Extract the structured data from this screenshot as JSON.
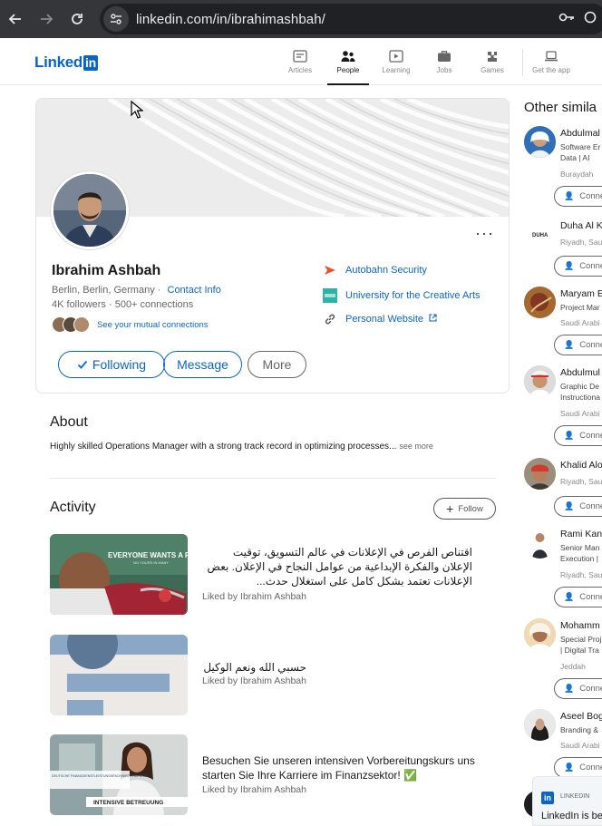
{
  "browser": {
    "url_host": "linkedin.com",
    "url_path": "/in/ibrahimashbah/"
  },
  "nav": {
    "logo_text": "Linked",
    "logo_in": "in",
    "items": [
      {
        "label": "Articles",
        "icon": "articles-icon"
      },
      {
        "label": "People",
        "icon": "people-icon",
        "active": true
      },
      {
        "label": "Learning",
        "icon": "learning-icon"
      },
      {
        "label": "Jobs",
        "icon": "jobs-icon"
      },
      {
        "label": "Games",
        "icon": "games-icon"
      },
      {
        "label": "Get the app",
        "icon": "laptop-icon"
      }
    ]
  },
  "profile": {
    "name": "Ibrahim Ashbah",
    "location": "Berlin, Berlin, Germany",
    "location_sep": " · ",
    "contact_info": "Contact Info",
    "followers": "4K followers",
    "conn_sep": " · ",
    "connections": "500+ connections",
    "mutual": "See your mutual connections",
    "associations": [
      {
        "label": "Autobahn Security",
        "icon": "autobahn-security-logo"
      },
      {
        "label": "University for the Creative Arts",
        "icon": "uca-logo"
      },
      {
        "label": "Personal Website",
        "icon": "link-icon"
      }
    ],
    "buttons": {
      "following": "Following",
      "message": "Message",
      "more": "More"
    },
    "kebab": "···"
  },
  "about": {
    "heading": "About",
    "text": "Highly skilled Operations Manager with a strong track record in optimizing processes...",
    "see_more": "see more"
  },
  "activity": {
    "heading": "Activity",
    "follow_label": "Follow",
    "posts": [
      {
        "text": "اقتناص الفرص في الإعلانات في عالم التسويق، توقيت الإعلان والفكرة الإبداعية من عوامل النجاح في الإعلان. بعض الإعلانات تعتمد بشكل كامل على استغلال حدث...",
        "liked": "Liked by Ibrahim Ashbah",
        "thumb_caption": "EVERYONE WANTS A PAIR",
        "thumb_subcaption": "NO YOURS IN MANY"
      },
      {
        "text": "حسبي الله ونعم الوكيل",
        "liked": "Liked by Ibrahim Ashbah"
      },
      {
        "text": "Besuchen Sie unseren intensiven Vorbereitungskurs uns starten Sie Ihre Karriere im Finanzsektor! ✅",
        "liked": "Liked by Ibrahim Ashbah",
        "thumb_caption": "INTENSIVE BETREUUNG",
        "thumb_small": "DEUTSCHE FINANZDIENSTLEISTUNGSFACHWIRT PRÜFUNG"
      }
    ]
  },
  "sidebar": {
    "heading": "Other simila",
    "connect_label": "Conne",
    "people": [
      {
        "name": "Abdulmal",
        "role1": "Software Er",
        "role2": "Data | AI",
        "loc": "Buraydah"
      },
      {
        "name": "Duha Al K",
        "role1": "",
        "role2": "",
        "loc": "Riyadh, Sau",
        "avatar_text": "DUHA"
      },
      {
        "name": "Maryam E",
        "role1": "Project Mar",
        "role2": "",
        "loc": "Saudi Arabi"
      },
      {
        "name": "Abdulmul",
        "role1": "Graphic De",
        "role2": "Instructiona",
        "loc": "Saudi Arabi"
      },
      {
        "name": "Khalid Alo",
        "role1": "",
        "role2": "",
        "loc": "Riyadh, Sau"
      },
      {
        "name": "Rami Kan",
        "role1": "Senior Man",
        "role2": "Execution |",
        "loc": "Riyadh, Sau"
      },
      {
        "name": "Mohamm",
        "role1": "Special Proj",
        "role2": "| Digital Tra",
        "loc": "Jeddah"
      },
      {
        "name": "Aseel Bog",
        "role1": "Branding &",
        "role2": "",
        "loc": "Saudi Arabi"
      }
    ],
    "promo": {
      "badge": "in",
      "tag": "LINKEDIN",
      "text": "LinkedIn is be"
    }
  },
  "colors": {
    "brand": "#0a66c2",
    "chrome_bg": "#35363a",
    "omnibox_bg": "#202124"
  }
}
